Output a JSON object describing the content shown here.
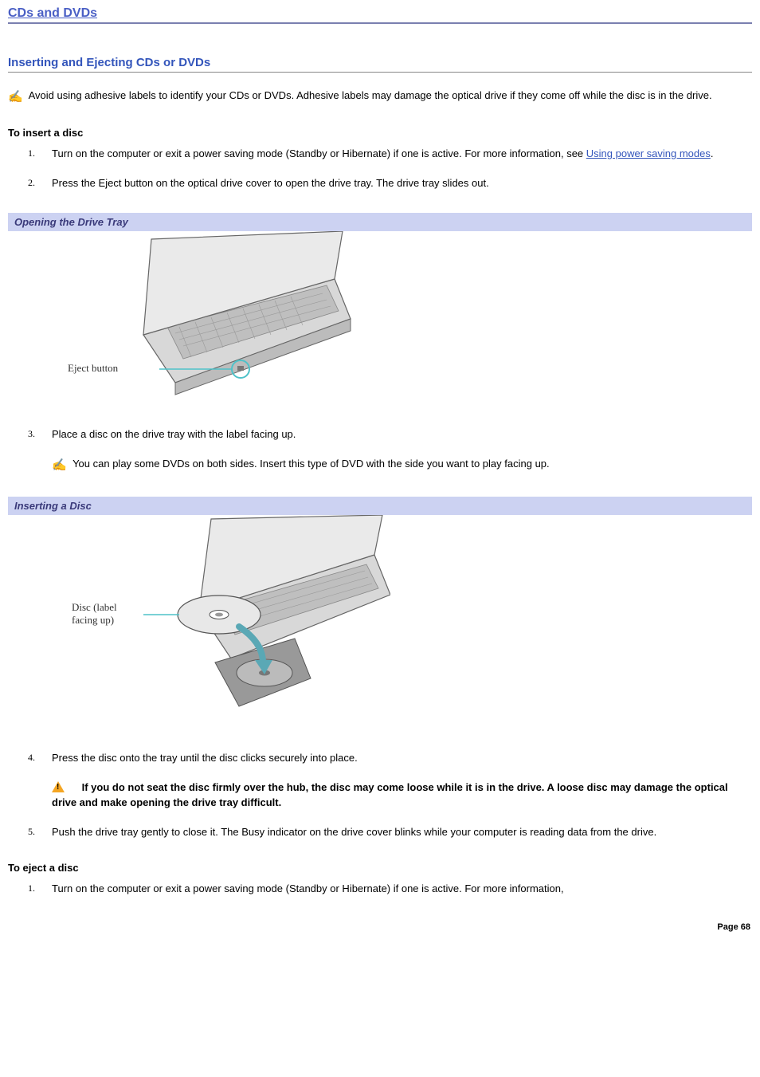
{
  "page_title": "CDs and DVDs",
  "section_title": "Inserting and Ejecting CDs or DVDs",
  "top_note": "Avoid using adhesive labels to identify your CDs or DVDs. Adhesive labels may damage the optical drive if they come off while the disc is in the drive.",
  "insert_heading": "To insert a disc",
  "link_text": "Using power saving modes",
  "step1_a": "Turn on the computer or exit a power saving mode (Standby or Hibernate) if one is active. For more information, see ",
  "step1_c": ".",
  "step2": "Press the Eject button on the optical drive cover to open the drive tray. The drive tray slides out.",
  "fig1_title": "Opening the Drive Tray",
  "fig1_label": "Eject button",
  "step3": "Place a disc on the drive tray with the label facing up.",
  "step3_note": "You can play some DVDs on both sides. Insert this type of DVD with the side you want to play facing up.",
  "fig2_title": "Inserting a Disc",
  "fig2_label1": "Disc (label",
  "fig2_label2": "facing up)",
  "step4": "Press the disc onto the tray until the disc clicks securely into place.",
  "step4_warn": "If you do not seat the disc firmly over the hub, the disc may come loose while it is in the drive. A loose disc may damage the optical drive and make opening the drive tray difficult.",
  "step5": "Push the drive tray gently to close it. The Busy indicator on the drive cover blinks while your computer is reading data from the drive.",
  "eject_heading": "To eject a disc",
  "eject_step1": "Turn on the computer or exit a power saving mode (Standby or Hibernate) if one is active. For more information,",
  "page_num": "Page 68"
}
